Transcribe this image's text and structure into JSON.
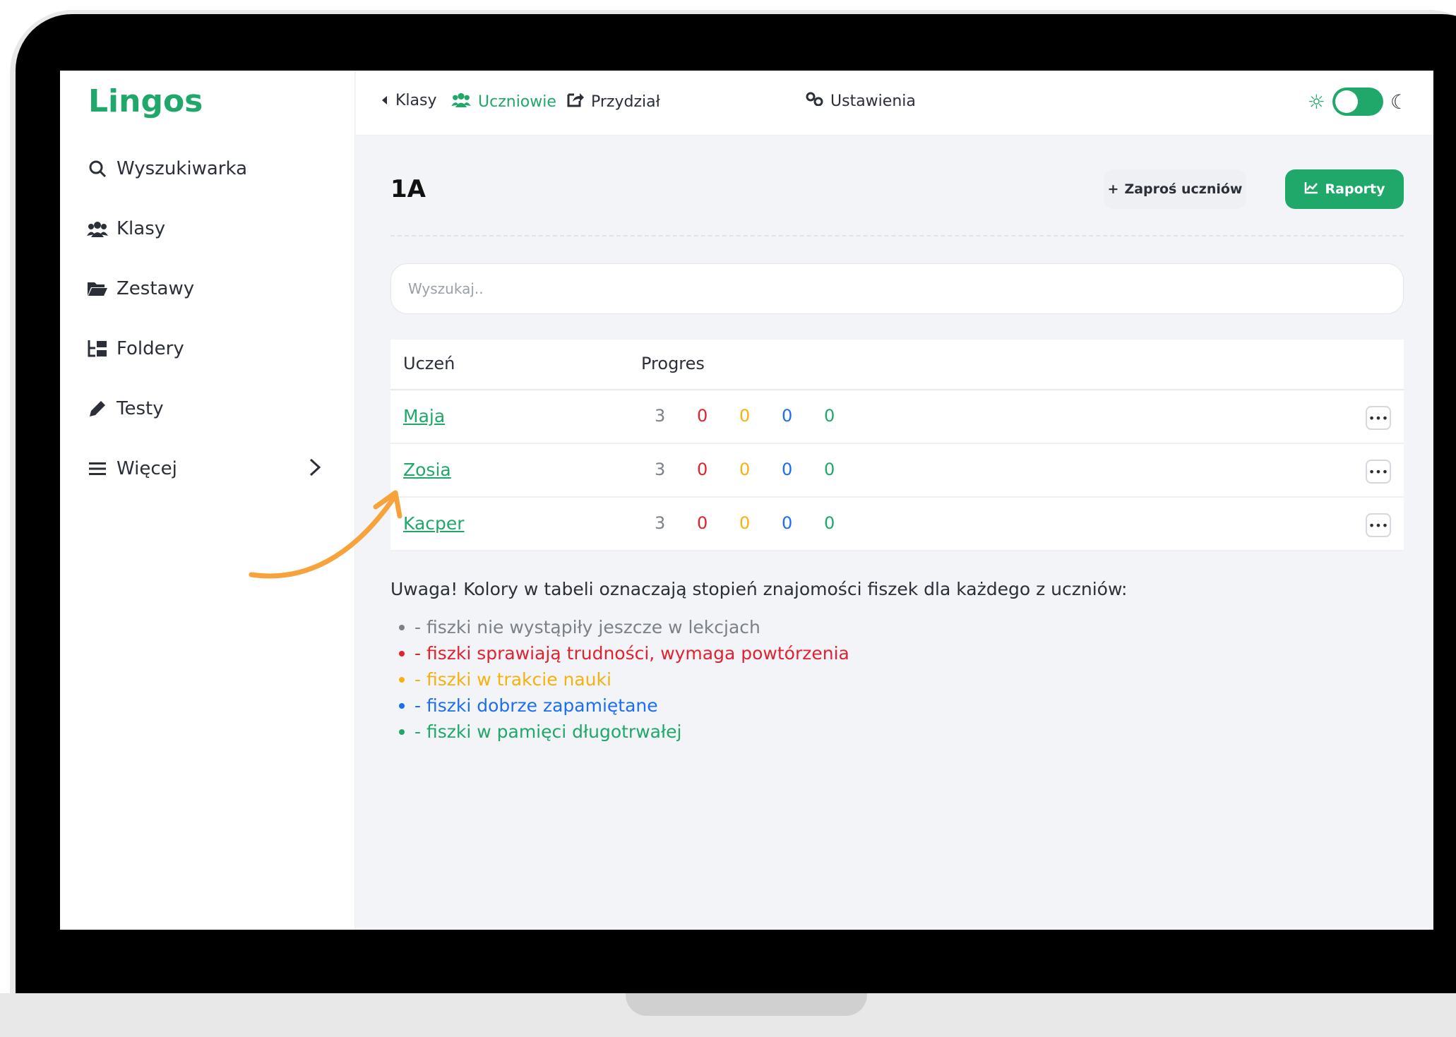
{
  "app": {
    "logo": "Lingos"
  },
  "sidebar": {
    "items": [
      {
        "label": "Wyszukiwarka",
        "icon": "search-icon"
      },
      {
        "label": "Klasy",
        "icon": "users-icon"
      },
      {
        "label": "Zestawy",
        "icon": "folder-open-icon"
      },
      {
        "label": "Foldery",
        "icon": "folder-tree-icon"
      },
      {
        "label": "Testy",
        "icon": "pencil-icon"
      },
      {
        "label": "Więcej",
        "icon": "menu-icon"
      }
    ]
  },
  "topbar": {
    "tabs": [
      {
        "label": "Klasy",
        "icon": "caret-left-icon"
      },
      {
        "label": "Uczniowie",
        "icon": "users-icon",
        "active": true
      },
      {
        "label": "Przydział",
        "icon": "share-icon"
      },
      {
        "label": "Ustawienia",
        "icon": "cogs-icon"
      }
    ],
    "theme": {
      "sun_icon": "sun-icon",
      "moon_icon": "moon-icon"
    }
  },
  "main": {
    "title": "1A",
    "invite_label": "Zaproś uczniów",
    "reports_label": "Raporty",
    "search_placeholder": "Wyszukaj..",
    "table": {
      "headers": [
        "Uczeń",
        "Progres"
      ],
      "rows": [
        {
          "name": "Maja",
          "progress": [
            3,
            0,
            0,
            0,
            0
          ]
        },
        {
          "name": "Zosia",
          "progress": [
            3,
            0,
            0,
            0,
            0
          ]
        },
        {
          "name": "Kacper",
          "progress": [
            3,
            0,
            0,
            0,
            0
          ]
        }
      ]
    },
    "note": "Uwaga! Kolory w tabeli oznaczają stopień znajomości fiszek dla każdego z uczniów:",
    "legend": [
      {
        "text": "- fiszki nie wystąpiły jeszcze w lekcjach",
        "color": "#7c8088"
      },
      {
        "text": "- fiszki sprawiają trudności, wymaga powtórzenia",
        "color": "#e0232f"
      },
      {
        "text": "- fiszki w trakcie nauki",
        "color": "#f6b10e"
      },
      {
        "text": "- fiszki dobrze zapamiętane",
        "color": "#1c6ef2"
      },
      {
        "text": "- fiszki w pamięci długotrwałej",
        "color": "#1fa86a"
      }
    ]
  },
  "colors": {
    "brand": "#1fa86a",
    "arrow": "#f7a23a"
  }
}
